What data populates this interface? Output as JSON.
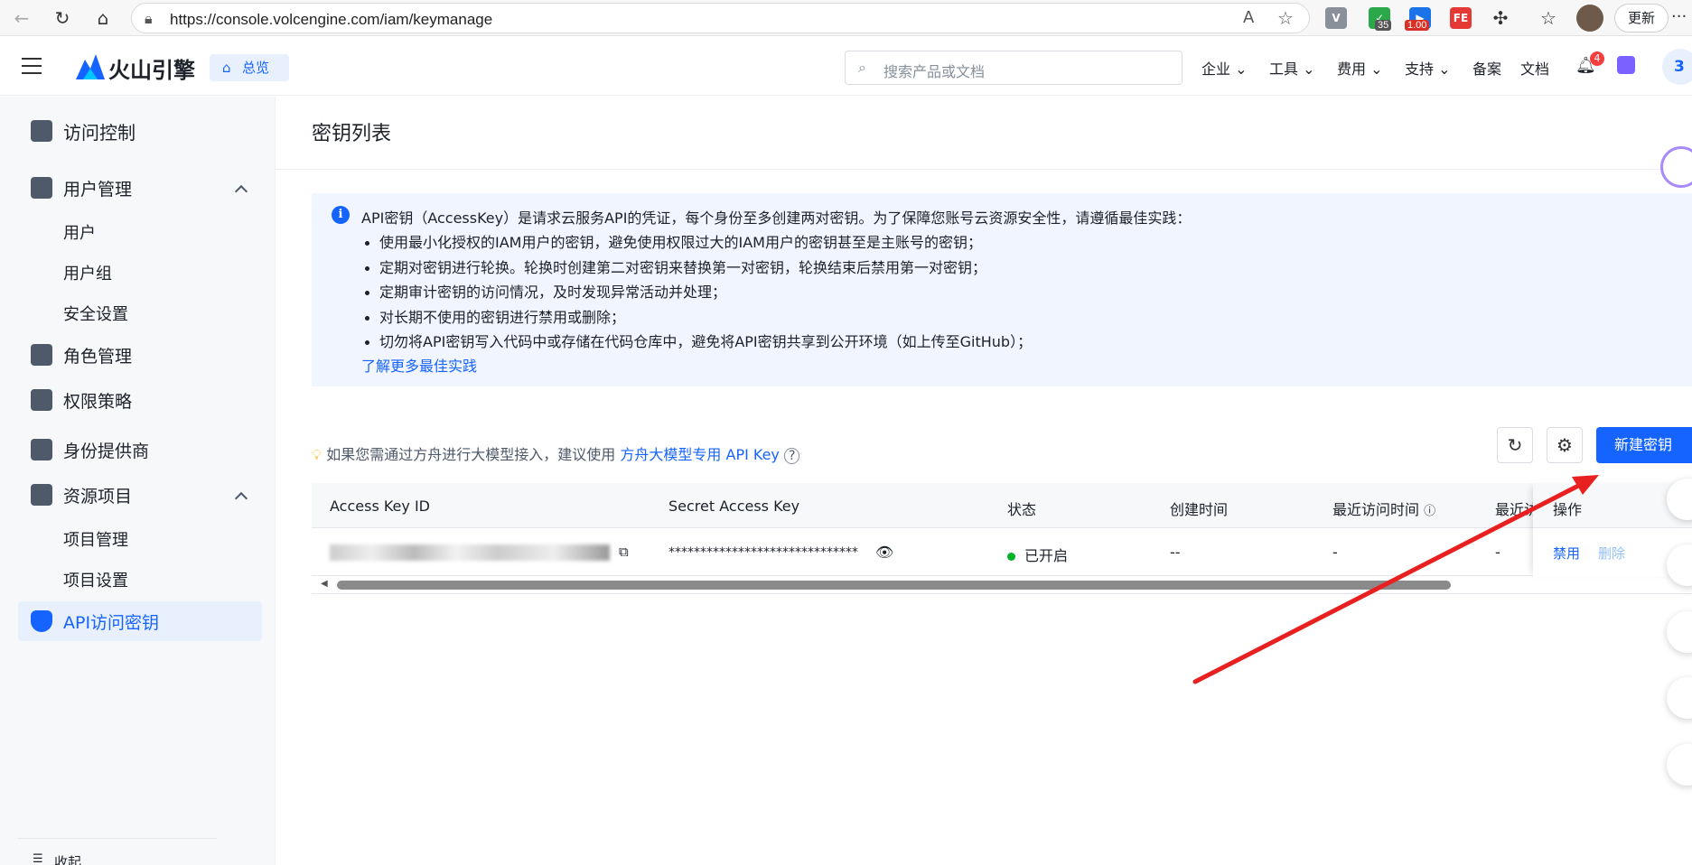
{
  "browser": {
    "url": "https://console.volcengine.com/iam/keymanage",
    "ext_badge_1": "35",
    "ext_badge_2": "1.00",
    "ext_fe": "FE",
    "update_label": "更新",
    "more_label": "···"
  },
  "header": {
    "brand": "火山引擎",
    "overview": "总览",
    "search_placeholder": "搜索产品或文档",
    "nav": [
      "企业",
      "工具",
      "费用",
      "支持",
      "备案",
      "文档"
    ],
    "notif_count": "4",
    "avatar_text": "3"
  },
  "sidebar": {
    "items": [
      {
        "label": "访问控制"
      },
      {
        "label": "用户管理"
      },
      {
        "label": "用户"
      },
      {
        "label": "用户组"
      },
      {
        "label": "安全设置"
      },
      {
        "label": "角色管理"
      },
      {
        "label": "权限策略"
      },
      {
        "label": "身份提供商"
      },
      {
        "label": "资源项目"
      },
      {
        "label": "项目管理"
      },
      {
        "label": "项目设置"
      },
      {
        "label": "API访问密钥"
      }
    ],
    "collapse": "收起"
  },
  "main": {
    "title": "密钥列表",
    "notice_lead": "API密钥（AccessKey）是请求云服务API的凭证，每个身份至多创建两对密钥。为了保障您账号云资源安全性，请遵循最佳实践：",
    "notice_items": [
      "使用最小化授权的IAM用户的密钥，避免使用权限过大的IAM用户的密钥甚至是主账号的密钥；",
      "定期对密钥进行轮换。轮换时创建第二对密钥来替换第一对密钥，轮换结束后禁用第一对密钥；",
      "定期审计密钥的访问情况，及时发现异常活动并处理；",
      "对长期不使用的密钥进行禁用或删除；",
      "切勿将API密钥写入代码中或存储在代码仓库中，避免将API密钥共享到公开环境（如上传至GitHub）；"
    ],
    "notice_more": "了解更多最佳实践",
    "tip_text": "如果您需通过方舟进行大模型接入，建议使用",
    "tip_link": "方舟大模型专用 API Key",
    "new_key_button": "新建密钥",
    "table": {
      "headers": [
        "Access Key ID",
        "Secret Access Key",
        "状态",
        "创建时间",
        "最近访问时间",
        "最近访",
        "操作"
      ],
      "row": {
        "secret": "******************************",
        "status": "已开启",
        "created": "--",
        "last_access": "-",
        "last_access2": "-",
        "action_disable": "禁用",
        "action_delete": "删除"
      }
    }
  },
  "colors": {
    "accent": "#1664ff",
    "status_on": "#00b42a",
    "arrow": "#e82020"
  }
}
